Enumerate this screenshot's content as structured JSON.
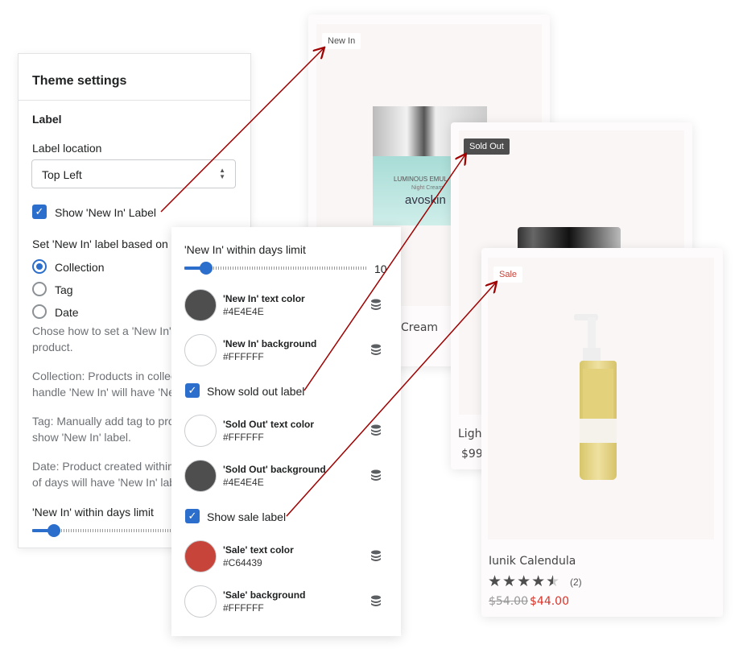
{
  "products": [
    {
      "badge": "New In",
      "name": "Cream",
      "jar_text": [
        "LUMINOUS EMUL",
        "Night Cream",
        "avoskin"
      ]
    },
    {
      "badge": "Sold Out",
      "name": "Light",
      "price": "$99."
    },
    {
      "badge": "Sale",
      "name": "Iunik Calendula",
      "rating": 4.5,
      "reviews": "(2)",
      "old_price": "$54.00",
      "price": "$44.00"
    }
  ],
  "theme_panel": {
    "title": "Theme settings",
    "section": "Label",
    "location_label": "Label location",
    "location_value": "Top Left",
    "show_new_in": "Show 'New In' Label",
    "based_on": "Set 'New In' label based on",
    "options": [
      "Collection",
      "Tag",
      "Date"
    ],
    "selected_option": "Collection",
    "help": [
      "Chose how to set a 'New In' label for a",
      "product.",
      "Collection: Products in collection with",
      "handle 'New In' will have 'New In' label.",
      "Tag: Manually add tag to product to",
      "show 'New In' label.",
      "Date: Product created within the number",
      "of days will have 'New In' label."
    ],
    "days_label": "'New In' within days limit"
  },
  "detail_panel": {
    "days_label": "'New In' within days limit",
    "days_value": "10",
    "colors": [
      {
        "label": "'New In' text color",
        "value": "#4E4E4E"
      },
      {
        "label": "'New In' background",
        "value": "#FFFFFF"
      },
      {
        "label": "'Sold Out' text color",
        "value": "#FFFFFF"
      },
      {
        "label": "'Sold Out' background",
        "value": "#4E4E4E"
      },
      {
        "label": "'Sale' text color",
        "value": "#C64439"
      },
      {
        "label": "'Sale' background",
        "value": "#FFFFFF"
      }
    ],
    "show_sold_out": "Show sold out label",
    "show_sale": "Show sale label"
  },
  "colors": {
    "accent": "#2c6ecb",
    "arrow": "#a00000",
    "sale": "#C64439"
  }
}
